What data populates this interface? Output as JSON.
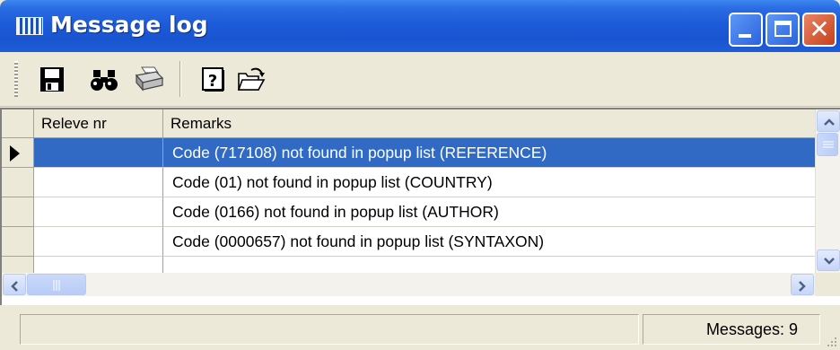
{
  "window": {
    "title": "Message log",
    "buttons": {
      "minimize": "minimize",
      "maximize": "maximize",
      "close": "✕"
    }
  },
  "toolbar": {
    "tools": [
      "save-icon",
      "binoculars-icon",
      "printer-icon",
      "help-icon",
      "open-folder-icon"
    ]
  },
  "grid": {
    "columns": [
      "Releve nr",
      "Remarks"
    ],
    "rows": [
      {
        "releve_nr": "",
        "remarks": "Code (717108) not found in popup list (REFERENCE)",
        "selected": true
      },
      {
        "releve_nr": "",
        "remarks": "Code (01) not found in popup list (COUNTRY)",
        "selected": false
      },
      {
        "releve_nr": "",
        "remarks": "Code (0166) not found in popup list (AUTHOR)",
        "selected": false
      },
      {
        "releve_nr": "",
        "remarks": "Code (0000657) not found in popup list (SYNTAXON)",
        "selected": false
      }
    ]
  },
  "status": {
    "left": "",
    "messages": "Messages: 9"
  },
  "colors": {
    "titlebar": "#1f5ed8",
    "selection": "#316ac5",
    "chrome": "#ece9d8"
  }
}
